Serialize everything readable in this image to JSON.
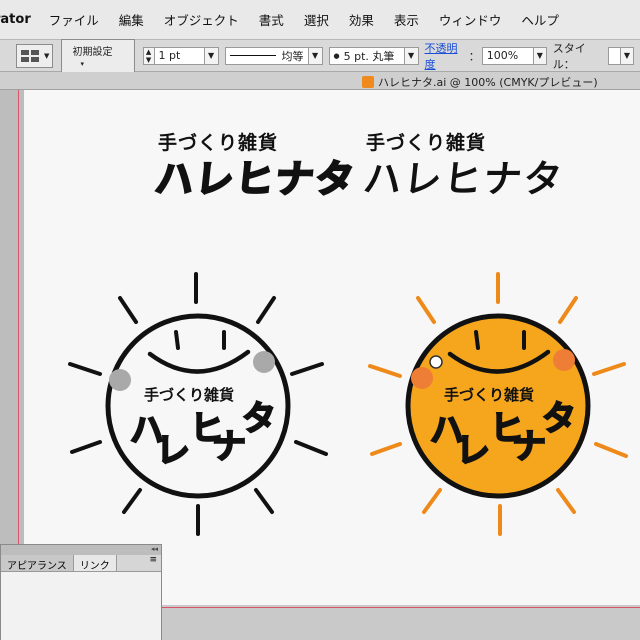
{
  "menubar": {
    "app_name": "rator",
    "items": [
      "ファイル",
      "編集",
      "オブジェクト",
      "書式",
      "選択",
      "効果",
      "表示",
      "ウィンドウ",
      "ヘルプ"
    ]
  },
  "controlbar": {
    "graphic_style_label": "初期設定",
    "stroke_weight": "1 pt",
    "profile": "均等",
    "brush": "5 pt. 丸筆",
    "opacity_label": "不透明度",
    "opacity_value": "100%",
    "style_label": "スタイル："
  },
  "document_tab": {
    "title": "ハレヒナタ.ai @ 100% (CMYK/プレビュー)"
  },
  "artwork": {
    "tagline": "手づくり雑貨",
    "brand": "ハレヒナタ",
    "sun_colors": {
      "fill_color": "#f6a61d",
      "ray_color": "#ee8a1a",
      "cheek_color": "#ee7d35",
      "ink": "#111111"
    }
  },
  "panel": {
    "tabs": [
      "アピアランス",
      "リンク"
    ]
  }
}
